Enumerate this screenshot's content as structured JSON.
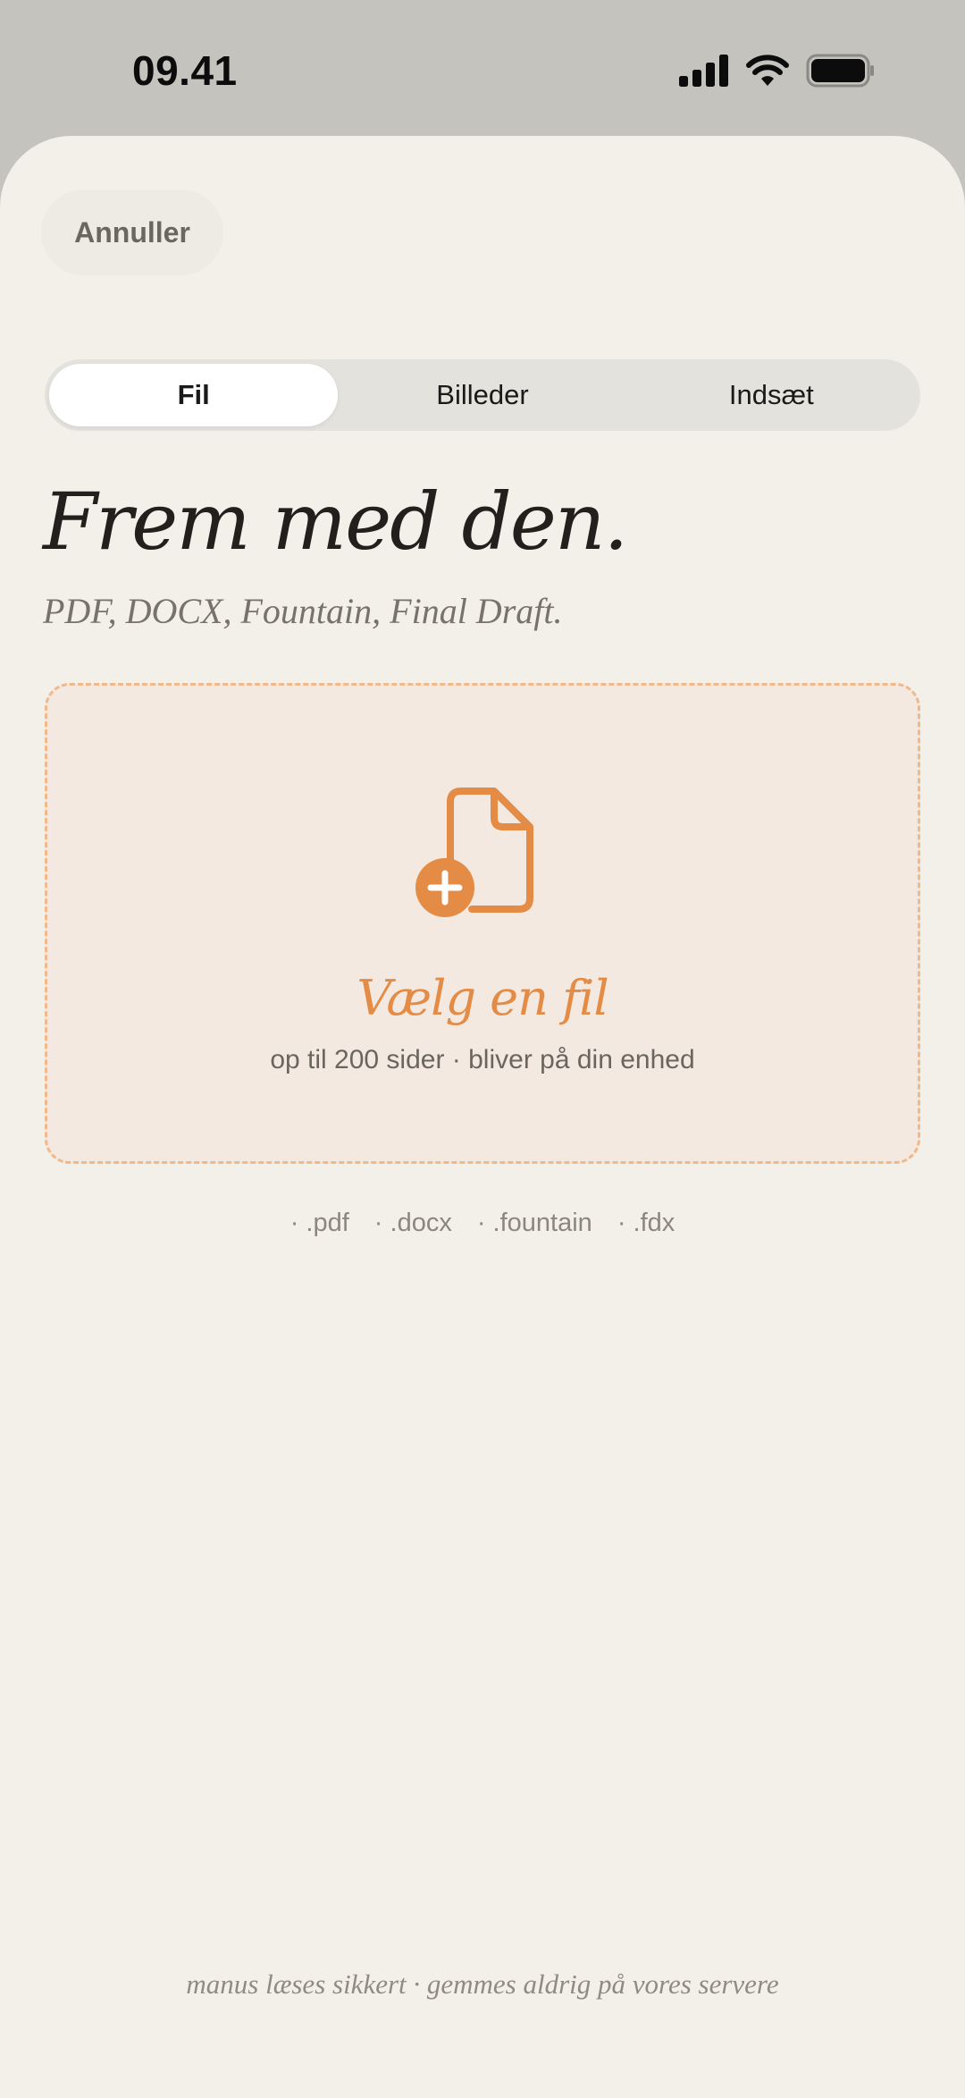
{
  "status_bar": {
    "time": "09.41",
    "icons": [
      "cellular-signal-icon",
      "wifi-icon",
      "battery-icon"
    ]
  },
  "header": {
    "cancel_label": "Annuller"
  },
  "tabs": [
    {
      "label": "Fil",
      "active": true
    },
    {
      "label": "Billeder",
      "active": false
    },
    {
      "label": "Indsæt",
      "active": false
    }
  ],
  "main": {
    "headline": "Frem med den.",
    "subline": "PDF, DOCX, Fountain, Final Draft."
  },
  "dropzone": {
    "icon": "file-add-icon",
    "title": "Vælg en fil",
    "subtitle": "op til 200 sider · bliver på din enhed"
  },
  "formats": [
    "· .pdf",
    "· .docx",
    "· .fountain",
    "· .fdx"
  ],
  "footer": {
    "note": "manus læses sikkert · gemmes aldrig på vores servere"
  },
  "colors": {
    "accent": "#e48c45",
    "sheet_background": "#f3f0ea",
    "dropzone_background": "#f4e9e0",
    "dropzone_border": "#f1b88a"
  }
}
